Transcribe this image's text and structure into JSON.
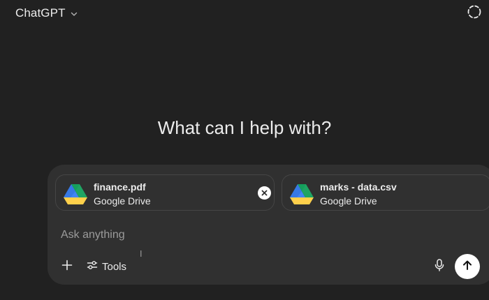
{
  "header": {
    "model_name": "ChatGPT",
    "model_menu_icon": "chevron-down-icon",
    "temporary_chat_icon": "dashed-circle-icon"
  },
  "main": {
    "heading": "What can I help with?"
  },
  "composer": {
    "attachments": [
      {
        "name": "finance.pdf",
        "source": "Google Drive",
        "icon": "google-drive-icon",
        "removable": true
      },
      {
        "name": "marks - data.csv",
        "source": "Google Drive",
        "icon": "google-drive-icon",
        "removable": false
      }
    ],
    "input": {
      "placeholder": "Ask anything",
      "value": ""
    },
    "toolbar": {
      "add_icon": "plus-icon",
      "tools_label": "Tools",
      "tools_icon": "sliders-icon",
      "mic_icon": "microphone-icon",
      "send_icon": "arrow-up-icon"
    }
  },
  "colors": {
    "background": "#212121",
    "composer": "#303030",
    "card_border": "#454545",
    "text": "#ececec",
    "placeholder": "#9b9b9b",
    "send_button": "#ffffff"
  }
}
